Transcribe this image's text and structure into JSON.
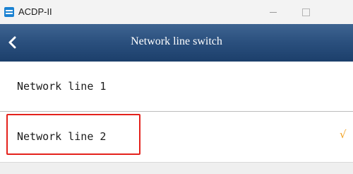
{
  "window": {
    "title": "ACDP-II"
  },
  "navbar": {
    "title": "Network line switch"
  },
  "lines": [
    {
      "label": "Network line 1",
      "selected": false
    },
    {
      "label": "Network line 2",
      "selected": true,
      "check": "√"
    }
  ],
  "colors": {
    "navbar": "#2a4f7d",
    "check": "#f2a01d",
    "highlight": "#e4221c"
  },
  "icons": {
    "back": "chevron-left-icon",
    "selected": "checkmark-icon"
  }
}
